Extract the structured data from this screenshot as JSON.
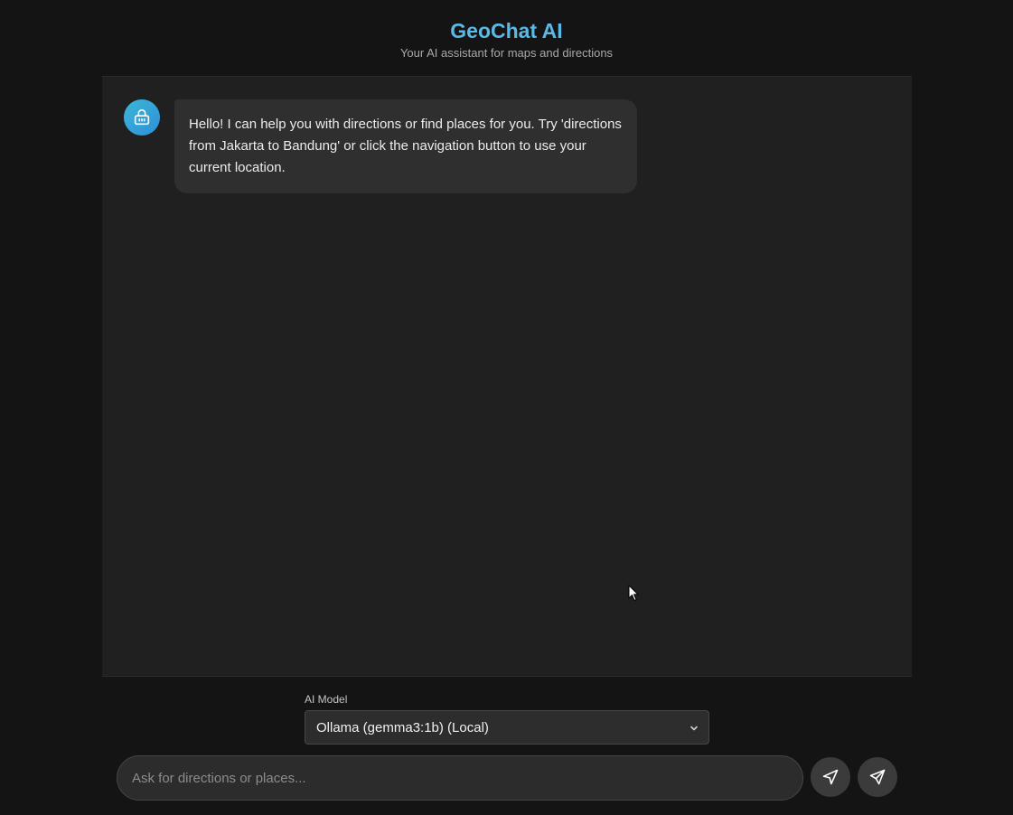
{
  "header": {
    "title": "GeoChat AI",
    "subtitle": "Your AI assistant for maps and directions"
  },
  "messages": [
    {
      "role": "assistant",
      "avatar_icon": "robot-icon",
      "text": "Hello! I can help you with directions or find places for you. Try 'directions from Jakarta to Bandung' or click the navigation button to use your current location."
    }
  ],
  "model_selector": {
    "label": "AI Model",
    "selected": "Ollama (gemma3:1b) (Local)"
  },
  "composer": {
    "placeholder": "Ask for directions or places...",
    "value": "",
    "nav_button_icon": "navigation-arrow-icon",
    "send_button_icon": "send-icon"
  },
  "colors": {
    "background": "#141414",
    "chat_background": "#202020",
    "accent": "#5ab9e6",
    "bubble": "#2f2f2f"
  }
}
